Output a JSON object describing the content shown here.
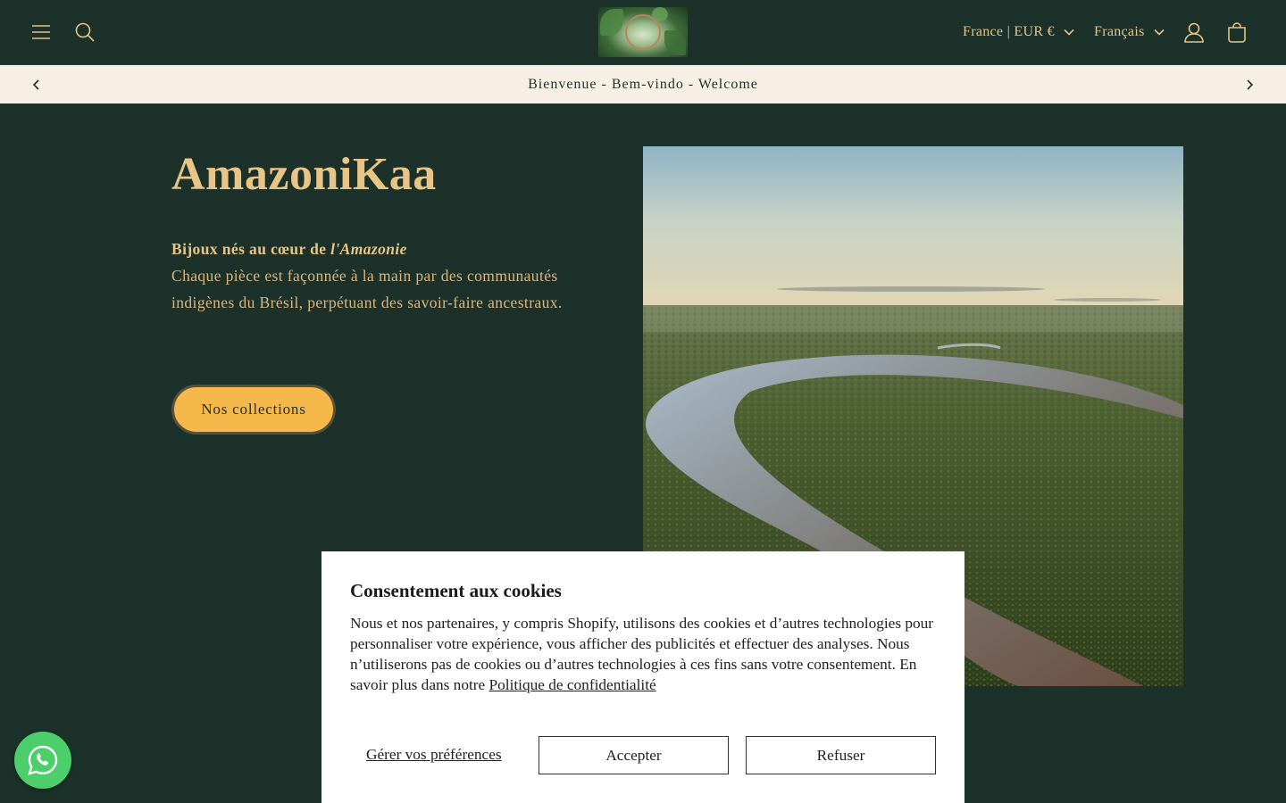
{
  "header": {
    "menu_icon": "hamburger-menu-icon",
    "search_icon": "search-icon",
    "logo_alt": "AmazoniKaa logo",
    "country_selector": "France | EUR €",
    "language_selector": "Français",
    "account_icon": "user-icon",
    "cart_icon": "shopping-bag-icon"
  },
  "announcement": {
    "text": "Bienvenue - Bem-vindo - Welcome",
    "prev_icon": "chevron-left-icon",
    "next_icon": "chevron-right-icon"
  },
  "hero": {
    "title": "AmazoniKaa",
    "lead_bold": "Bijoux nés au cœur de ",
    "lead_italic": "l'Amazonie",
    "body": "Chaque pièce est façonnée à la main par des communautés indigènes du Brésil, perpétuant des savoir-faire ancestraux.",
    "cta_label": "Nos collections",
    "image_alt": "Aerial view of the Amazon river winding through rainforest"
  },
  "cookie_banner": {
    "title": "Consentement aux cookies",
    "text": "Nous et nos partenaires, y compris Shopify, utilisons des cookies et d’autres technologies pour personnaliser votre expérience, vous afficher des publicités et effectuer des analyses. Nous n’utiliserons pas de cookies ou d’autres technologies à ces fins sans votre consentement. En savoir plus dans notre ",
    "policy_link": "Politique de confidentialité",
    "manage_label": "Gérer vos préférences",
    "accept_label": "Accepter",
    "decline_label": "Refuser"
  },
  "floating": {
    "whatsapp_icon": "whatsapp-icon"
  },
  "colors": {
    "background": "#1b3129",
    "accent_gold": "#e8c486",
    "cta": "#f7b84b",
    "announcement_bg": "#f7efe4",
    "whatsapp": "#4ccf6a"
  }
}
